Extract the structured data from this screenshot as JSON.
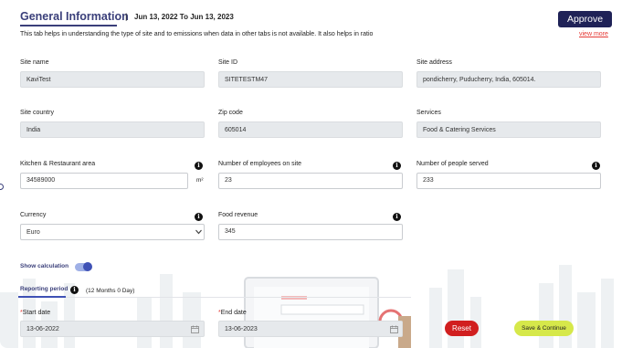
{
  "header": {
    "title": "General Information",
    "separator": "|",
    "date_range": "Jun 13, 2022 To Jun 13, 2023",
    "description": "This tab helps in understanding the type of site and to emissions when data in other tabs is not available. It also helps in ratio",
    "approve_label": "Approve",
    "view_more_label": "view more"
  },
  "fields": {
    "site_name": {
      "label": "Site name",
      "value": "KaviTest"
    },
    "site_id": {
      "label": "Site ID",
      "value": "SITETESTM47"
    },
    "site_address": {
      "label": "Site address",
      "value": "pondicherry, Puducherry, India, 605014."
    },
    "site_country": {
      "label": "Site country",
      "value": "India"
    },
    "zip_code": {
      "label": "Zip code",
      "value": "605014"
    },
    "services": {
      "label": "Services",
      "value": "Food & Catering Services"
    },
    "kitchen_area": {
      "label": "Kitchen & Restaurant area",
      "value": "34589000",
      "unit": "m²"
    },
    "employees": {
      "label": "Number of employees on site",
      "value": "23"
    },
    "people_served": {
      "label": "Number of people served",
      "value": "233"
    },
    "currency": {
      "label": "Currency",
      "value": "Euro"
    },
    "food_revenue": {
      "label": "Food revenue",
      "value": "345"
    }
  },
  "calculation": {
    "label": "Show calculation",
    "enabled": true
  },
  "reporting": {
    "tab_label": "Reporting period",
    "range_text": "(12 Months 0 Day)",
    "start_date": {
      "required_mark": "*",
      "label": "Start date",
      "value": "13-06-2022"
    },
    "end_date": {
      "required_mark": "*",
      "label": "End date",
      "value": "13-06-2023"
    }
  },
  "actions": {
    "reset_label": "Reset",
    "save_label": "Save & Continue"
  },
  "icons": {
    "info": "info-icon",
    "calendar": "calendar-icon",
    "dropdown": "chevron-down-icon"
  },
  "colors": {
    "primary": "#1f2257",
    "accent": "#3f51b5",
    "reset": "#d11f1f",
    "save": "#d6e84a",
    "link": "#e53935"
  }
}
